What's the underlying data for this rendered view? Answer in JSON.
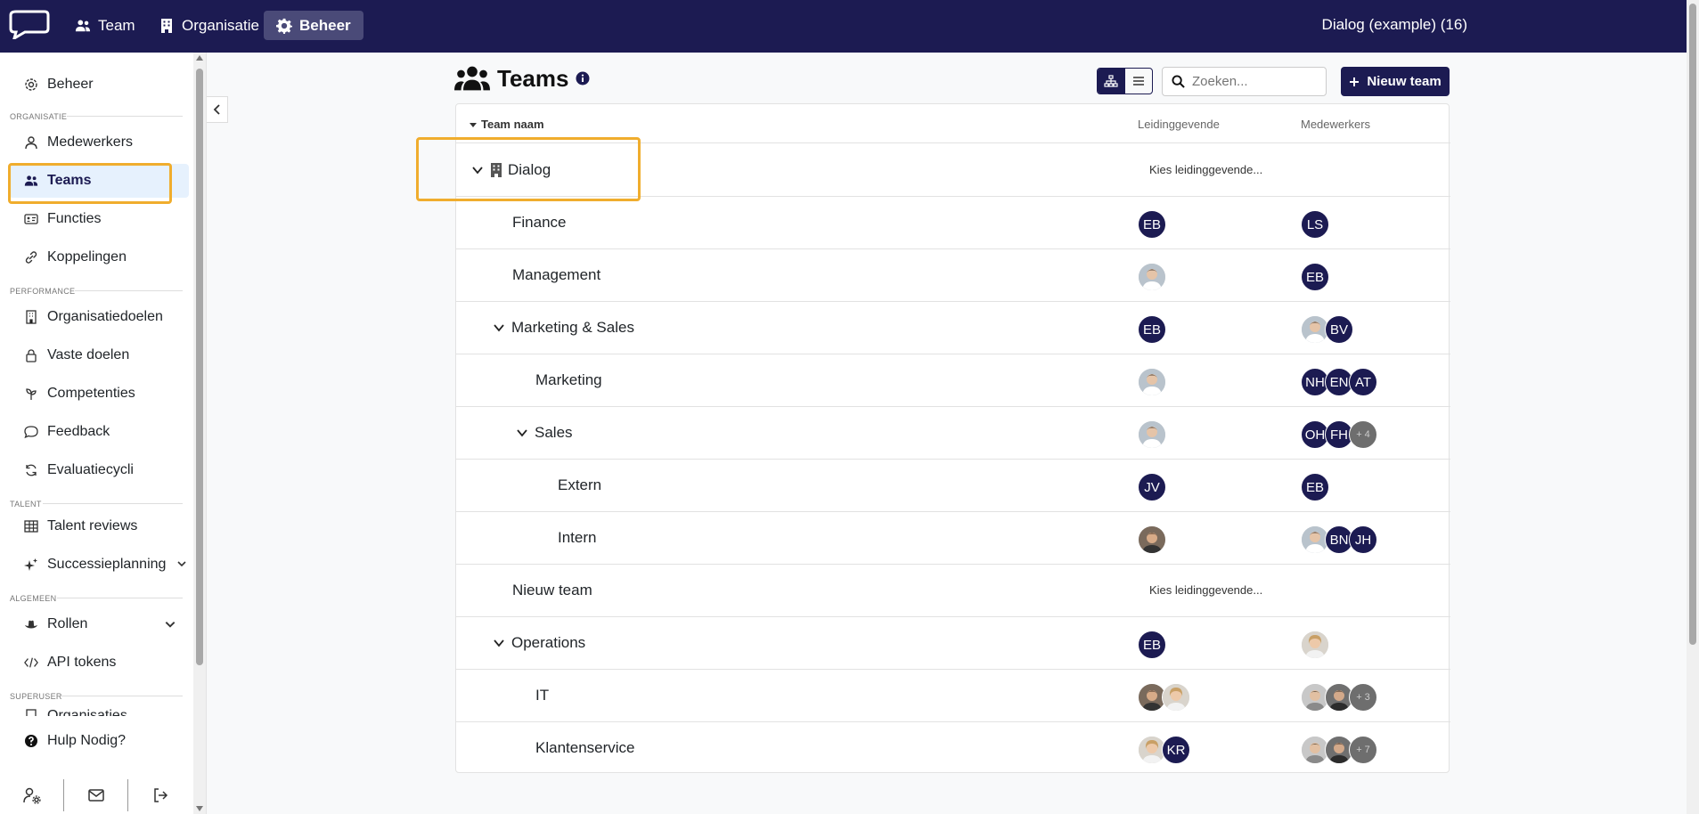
{
  "topbar": {
    "nav": [
      {
        "label": "Team",
        "icon": "users-icon"
      },
      {
        "label": "Organisatie",
        "icon": "building-icon"
      },
      {
        "label": "Beheer",
        "icon": "gear-icon"
      }
    ],
    "org_name": "Dialog (example) (16)"
  },
  "sidebar": {
    "top_item": "Beheer",
    "sections": {
      "organisatie": "ORGANISATIE",
      "performance": "PERFORMANCE",
      "talent": "TALENT",
      "algemeen": "ALGEMEEN",
      "superuser": "SUPERUSER"
    },
    "items": {
      "medewerkers": "Medewerkers",
      "teams": "Teams",
      "functies": "Functies",
      "koppelingen": "Koppelingen",
      "organisatiedoelen": "Organisatiedoelen",
      "vaste_doelen": "Vaste doelen",
      "competenties": "Competenties",
      "feedback": "Feedback",
      "evaluatiecycli": "Evaluatiecycli",
      "talent_reviews": "Talent reviews",
      "successieplanning": "Successieplanning",
      "rollen": "Rollen",
      "api_tokens": "API tokens",
      "organisaties": "Organisaties"
    },
    "help": "Hulp Nodig?"
  },
  "main": {
    "title": "Teams",
    "search_placeholder": "Zoeken...",
    "new_button": "Nieuw team",
    "columns": {
      "name": "Team naam",
      "lead": "Leidinggevende",
      "members": "Medewerkers"
    },
    "choose_lead": "Kies leidinggevende...",
    "rows": [
      {
        "name": "Dialog"
      },
      {
        "name": "Finance",
        "lead": [
          "EB"
        ],
        "members": [
          "LS"
        ]
      },
      {
        "name": "Management",
        "lead": [],
        "members": [
          "EB"
        ]
      },
      {
        "name": "Marketing & Sales",
        "lead": [
          "EB"
        ],
        "members": [
          "BV"
        ]
      },
      {
        "name": "Marketing",
        "lead": [],
        "members": [
          "NH",
          "EN",
          "AT"
        ]
      },
      {
        "name": "Sales",
        "lead": [],
        "members": [
          "OH",
          "FH",
          "+ 4"
        ]
      },
      {
        "name": "Extern",
        "lead": [
          "JV"
        ],
        "members": [
          "EB"
        ]
      },
      {
        "name": "Intern",
        "lead": [],
        "members": [
          "BN",
          "JH"
        ]
      },
      {
        "name": "Nieuw team"
      },
      {
        "name": "Operations",
        "lead": [
          "EB"
        ],
        "members": []
      },
      {
        "name": "IT",
        "lead": [],
        "members": [
          "+ 3"
        ]
      },
      {
        "name": "Klantenservice",
        "lead": [
          "KR"
        ],
        "members": [
          "+ 7"
        ]
      }
    ]
  },
  "colors": {
    "navy": "#1c1b52",
    "highlight": "#f0ad2d",
    "active_bg": "#e6f1fd"
  }
}
